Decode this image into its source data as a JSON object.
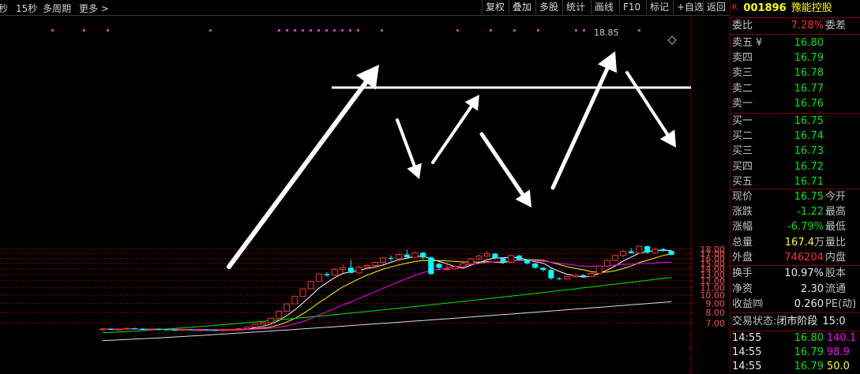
{
  "toolbar": {
    "left_items": [
      "秒",
      "15秒",
      "多周期",
      "更多"
    ],
    "more_arrow": ">",
    "buttons": [
      "复权",
      "叠加",
      "多股",
      "统计",
      "画线",
      "F10",
      "标记",
      "+自选",
      "返回"
    ]
  },
  "price_axis": {
    "ticks": [
      "18.00",
      "17.00",
      "16.00",
      "15.00",
      "14.00",
      "13.00",
      "12.00",
      "11.00",
      "10.00",
      "9.00",
      "8.00",
      "7.00"
    ]
  },
  "chart_annotation": {
    "high_label": "18.85"
  },
  "chart_data": {
    "type": "candlestick",
    "ylim": [
      6.3,
      19.6
    ],
    "y_scale": "log",
    "grid": true,
    "high_label": "18.85",
    "candles": [
      [
        6.45,
        6.55,
        6.35,
        6.5
      ],
      [
        6.5,
        6.55,
        6.4,
        6.45
      ],
      [
        6.45,
        6.52,
        6.38,
        6.48
      ],
      [
        6.48,
        6.6,
        6.42,
        6.55
      ],
      [
        6.55,
        6.62,
        6.45,
        6.5
      ],
      [
        6.5,
        6.58,
        6.4,
        6.42
      ],
      [
        6.42,
        6.52,
        6.38,
        6.48
      ],
      [
        6.48,
        6.55,
        6.4,
        6.45
      ],
      [
        6.45,
        6.5,
        6.38,
        6.42
      ],
      [
        6.42,
        6.48,
        6.35,
        6.4
      ],
      [
        6.4,
        6.48,
        6.34,
        6.45
      ],
      [
        6.45,
        6.5,
        6.38,
        6.4
      ],
      [
        6.4,
        6.46,
        6.34,
        6.42
      ],
      [
        6.42,
        6.48,
        6.36,
        6.4
      ],
      [
        6.4,
        6.45,
        6.33,
        6.38
      ],
      [
        6.38,
        6.45,
        6.32,
        6.42
      ],
      [
        6.42,
        6.5,
        6.38,
        6.46
      ],
      [
        6.46,
        6.56,
        6.4,
        6.52
      ],
      [
        6.52,
        6.7,
        6.48,
        6.65
      ],
      [
        6.65,
        6.95,
        6.6,
        6.9
      ],
      [
        6.9,
        7.1,
        6.85,
        7.05
      ],
      [
        7.05,
        7.5,
        7.0,
        7.45
      ],
      [
        7.45,
        8.2,
        7.4,
        8.15
      ],
      [
        8.15,
        9.0,
        8.1,
        8.95
      ],
      [
        8.95,
        9.9,
        8.9,
        9.85
      ],
      [
        9.85,
        10.9,
        9.8,
        10.84
      ],
      [
        10.84,
        11.95,
        10.8,
        11.92
      ],
      [
        11.92,
        13.15,
        11.9,
        13.1
      ],
      [
        13.1,
        13.4,
        12.6,
        12.9
      ],
      [
        12.9,
        14.1,
        12.8,
        13.9
      ],
      [
        13.9,
        14.8,
        13.3,
        14.2
      ],
      [
        14.2,
        15.7,
        13.2,
        13.3
      ],
      [
        13.3,
        14.5,
        13.2,
        14.3
      ],
      [
        14.3,
        14.8,
        13.9,
        14.6
      ],
      [
        14.6,
        15.4,
        14.3,
        15.2
      ],
      [
        15.2,
        16.3,
        14.9,
        16.1
      ],
      [
        16.1,
        16.6,
        15.5,
        15.9
      ],
      [
        15.9,
        17.0,
        15.7,
        16.8
      ],
      [
        16.8,
        17.9,
        16.0,
        16.2
      ],
      [
        16.2,
        17.5,
        16.0,
        17.2
      ],
      [
        17.2,
        17.4,
        15.8,
        16.2
      ],
      [
        16.2,
        16.4,
        13.0,
        13.1
      ],
      [
        14.9,
        15.1,
        13.8,
        14.2
      ],
      [
        13.9,
        15.2,
        13.7,
        14.0
      ],
      [
        14.0,
        14.6,
        13.8,
        14.4
      ],
      [
        14.4,
        15.2,
        14.2,
        14.9
      ],
      [
        14.9,
        16.1,
        14.7,
        15.9
      ],
      [
        15.9,
        16.8,
        15.6,
        16.5
      ],
      [
        16.5,
        17.6,
        16.3,
        17.0
      ],
      [
        17.0,
        17.1,
        15.8,
        16.0
      ],
      [
        16.0,
        16.1,
        14.9,
        15.2
      ],
      [
        15.2,
        16.8,
        15.0,
        16.6
      ],
      [
        16.6,
        16.7,
        15.6,
        15.7
      ],
      [
        15.7,
        15.9,
        14.8,
        15.0
      ],
      [
        15.0,
        15.1,
        14.0,
        14.2
      ],
      [
        14.2,
        14.3,
        13.5,
        13.8
      ],
      [
        13.8,
        14.2,
        12.2,
        12.4
      ],
      [
        12.4,
        12.6,
        12.1,
        12.3
      ],
      [
        12.3,
        12.8,
        12.2,
        12.7
      ],
      [
        12.7,
        13.1,
        12.5,
        12.9
      ],
      [
        12.9,
        13.1,
        12.6,
        12.7
      ],
      [
        12.7,
        13.3,
        12.6,
        13.2
      ],
      [
        13.2,
        14.6,
        13.1,
        14.5
      ],
      [
        14.5,
        15.8,
        14.3,
        15.6
      ],
      [
        15.6,
        16.8,
        15.4,
        16.6
      ],
      [
        16.6,
        17.7,
        16.3,
        17.5
      ],
      [
        17.5,
        18.2,
        17.0,
        17.1
      ],
      [
        17.1,
        18.85,
        17.0,
        18.7
      ],
      [
        18.7,
        18.8,
        17.0,
        17.2
      ],
      [
        17.2,
        18.4,
        17.0,
        18.0
      ],
      [
        18.0,
        18.3,
        17.4,
        17.6
      ],
      [
        17.6,
        17.8,
        16.6,
        16.75
      ]
    ],
    "ma_lines": {
      "ma5": {
        "color": "#ffffff"
      },
      "ma10": {
        "color": "#ffff00"
      },
      "ma20": {
        "color": "#ff00ff"
      },
      "ma60": {
        "color": "#00e600"
      },
      "ma120": {
        "color": "#dddddd"
      }
    },
    "colors": {
      "up": "#ff3232",
      "down": "#00ffff",
      "grid": "#7a0000"
    }
  },
  "quote": {
    "badge": "R",
    "code": "001896",
    "name": "豫能控股",
    "weibi_label": "委比",
    "weibi_value": "7.28%",
    "weicha_label": "委差",
    "asks": [
      {
        "label": "卖五",
        "mark": "¥",
        "price": "16.80"
      },
      {
        "label": "卖四",
        "price": "16.79"
      },
      {
        "label": "卖三",
        "price": "16.78"
      },
      {
        "label": "卖二",
        "price": "16.77"
      },
      {
        "label": "卖一",
        "price": "16.76"
      }
    ],
    "bids": [
      {
        "label": "买一",
        "price": "16.75"
      },
      {
        "label": "买二",
        "price": "16.74"
      },
      {
        "label": "买三",
        "price": "16.73"
      },
      {
        "label": "买四",
        "price": "16.72"
      },
      {
        "label": "买五",
        "price": "16.71"
      }
    ],
    "stats": [
      {
        "label": "现价",
        "value": "16.75",
        "right": "今开",
        "color": "green"
      },
      {
        "label": "涨跌",
        "value": "-1.22",
        "right": "最高",
        "color": "green"
      },
      {
        "label": "涨幅",
        "value": "-6.79%",
        "right": "最低",
        "color": "green"
      },
      {
        "label": "总量",
        "value": "167.4",
        "unit": "万",
        "right": "量比",
        "color": "yellow"
      },
      {
        "label": "外盘",
        "value": "746204",
        "right": "内盘",
        "color": "red"
      }
    ],
    "stats2": [
      {
        "label": "换手",
        "value": "10.97%",
        "right": "股本"
      },
      {
        "label": "净资",
        "value": "2.30",
        "right": "流通"
      },
      {
        "label": "收益㈣",
        "value": "0.260",
        "right": "PE(动)"
      }
    ],
    "status_label": "交易状态:",
    "status_value": "闭市阶段",
    "status_time": "15:0",
    "ticks": [
      {
        "time": "14:55",
        "price": "16.80",
        "vol": "140.1",
        "vol_color": "magenta"
      },
      {
        "time": "14:55",
        "price": "16.79",
        "vol": "98.9",
        "vol_color": "magenta"
      },
      {
        "time": "14:55",
        "price": "16.79",
        "vol": "50.0",
        "vol_color": "yellow"
      }
    ]
  }
}
